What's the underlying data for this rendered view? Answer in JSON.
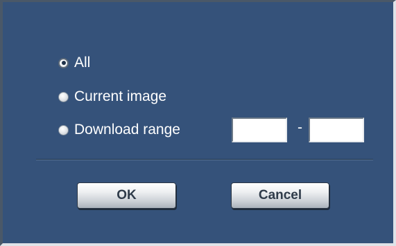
{
  "download_dialog": {
    "options": [
      {
        "label": "All",
        "selected": true
      },
      {
        "label": "Current image",
        "selected": false
      },
      {
        "label": "Download range",
        "selected": false
      }
    ],
    "range": {
      "start_value": "",
      "separator": "-",
      "end_value": ""
    },
    "buttons": {
      "ok_label": "OK",
      "cancel_label": "Cancel"
    },
    "colors": {
      "dialog_background": "#35527a",
      "text": "#ffffff"
    }
  }
}
